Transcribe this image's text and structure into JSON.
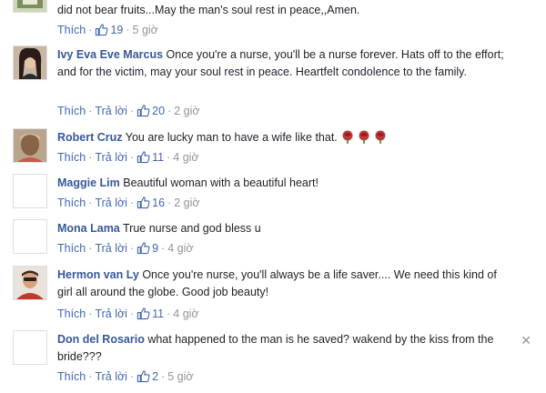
{
  "labels": {
    "like": "Thích",
    "reply": "Trả lời",
    "sep": "·"
  },
  "comments": [
    {
      "name": "",
      "text": "did not bear fruits...May the man's soul rest in peace,,Amen.",
      "has_reply": false,
      "likes": "19",
      "time": "5 giờ"
    },
    {
      "name": "Ivy Eva Eve Marcus",
      "text": "Once you're a nurse, you'll be a nurse forever. Hats off to the effort; and for the victim, may your soul rest in peace. Heartfelt condolence to the family.",
      "has_reply": true,
      "likes": "20",
      "time": "2 giờ"
    },
    {
      "name": "Robert Cruz",
      "text": "You are lucky man to have a wife like that.",
      "has_reply": true,
      "likes": "11",
      "time": "4 giờ"
    },
    {
      "name": "Maggie Lim",
      "text": "Beautiful woman with a beautiful heart!",
      "has_reply": true,
      "likes": "16",
      "time": "2 giờ"
    },
    {
      "name": "Mona Lama",
      "text": "True nurse and god bless u",
      "has_reply": true,
      "likes": "9",
      "time": "4 giờ"
    },
    {
      "name": "Hermon van Ly",
      "text": "Once you're nurse, you'll always be a life saver.... We need this kind of girl all around the globe. Good job beauty!",
      "has_reply": true,
      "likes": "11",
      "time": "4 giờ"
    },
    {
      "name": "Don del Rosario",
      "text": "what happened to the man is he saved? wakend by the kiss from the bride???",
      "has_reply": true,
      "likes": "2",
      "time": "5 giờ",
      "close": "✕"
    }
  ]
}
